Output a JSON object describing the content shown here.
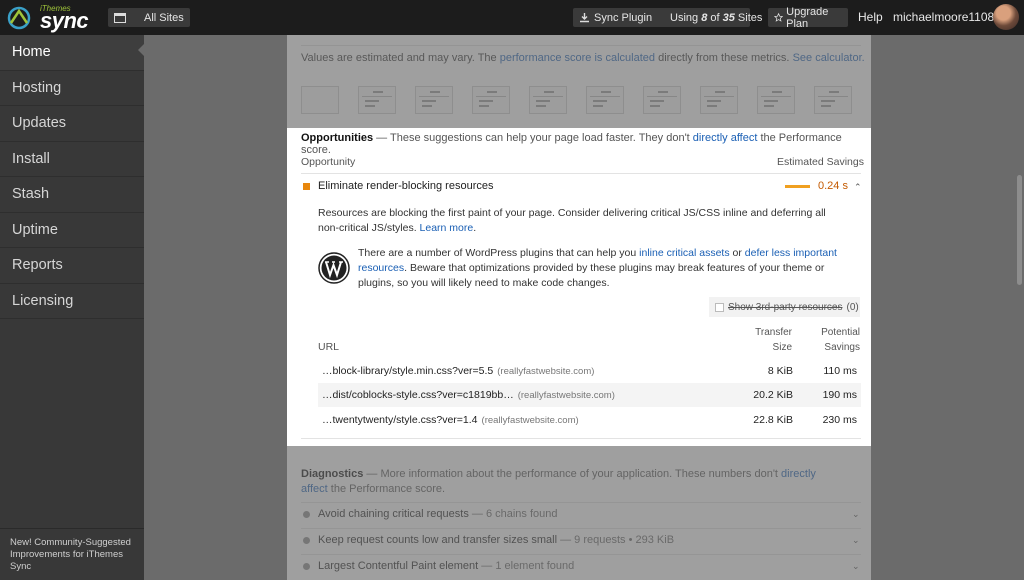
{
  "topbar": {
    "logo_small": "iThemes",
    "logo_big": "sync",
    "all_sites": "All Sites",
    "sync_plugin": "Sync Plugin",
    "using_prefix": "Using ",
    "using_count": "8",
    "using_mid": " of ",
    "using_total": "35",
    "using_suffix": " Sites",
    "upgrade": "Upgrade Plan",
    "help": "Help",
    "username": "michaelmoore1108"
  },
  "sidebar": {
    "items": [
      {
        "label": "Home"
      },
      {
        "label": "Hosting"
      },
      {
        "label": "Updates"
      },
      {
        "label": "Install"
      },
      {
        "label": "Stash"
      },
      {
        "label": "Uptime"
      },
      {
        "label": "Reports"
      },
      {
        "label": "Licensing"
      }
    ],
    "footer": "New! Community-Suggested Improvements for iThemes Sync"
  },
  "metrics_note": {
    "prefix": "Values are estimated and may vary. The ",
    "link1": "performance score is calculated",
    "mid": " directly from these metrics. ",
    "link2": "See calculator."
  },
  "opportunities": {
    "title": "Opportunities",
    "subtitle_prefix": " — These suggestions can help your page load faster. They don't ",
    "subtitle_link": "directly affect",
    "subtitle_suffix": " the Performance score.",
    "col_opportunity": "Opportunity",
    "col_savings": "Estimated Savings",
    "audit": {
      "label": "Eliminate render-blocking resources",
      "savings": "0.24 s"
    },
    "description_prefix": "Resources are blocking the first paint of your page. Consider delivering critical JS/CSS inline and deferring all non-critical JS/styles. ",
    "description_link": "Learn more",
    "description_suffix": ".",
    "wp_prefix": "There are a number of WordPress plugins that can help you ",
    "wp_link1": "inline critical assets",
    "wp_mid": " or ",
    "wp_link2": "defer less important resources",
    "wp_suffix": ". Beware that optimizations provided by these plugins may break features of your theme or plugins, so you will likely need to make code changes.",
    "third_party_label": "Show 3rd-party resources",
    "third_party_count": "(0)",
    "table": {
      "col_url": "URL",
      "col_transfer_1": "Transfer",
      "col_transfer_2": "Size",
      "col_potential_1": "Potential",
      "col_potential_2": "Savings",
      "rows": [
        {
          "url": "…block-library/style.min.css?ver=5.5",
          "host": "(reallyfastwebsite.com)",
          "size": "8 KiB",
          "savings": "110 ms"
        },
        {
          "url": "…dist/coblocks-style.css?ver=c1819bb…",
          "host": "(reallyfastwebsite.com)",
          "size": "20.2 KiB",
          "savings": "190 ms"
        },
        {
          "url": "…twentytwenty/style.css?ver=1.4",
          "host": "(reallyfastwebsite.com)",
          "size": "22.8 KiB",
          "savings": "230 ms"
        }
      ]
    }
  },
  "diagnostics": {
    "title": "Diagnostics",
    "subtitle_prefix": " — More information about the performance of your application. These numbers don't ",
    "subtitle_link": "directly affect",
    "subtitle_suffix": " the Performance score.",
    "items": [
      {
        "label": "Avoid chaining critical requests",
        "sub": " — 6 chains found"
      },
      {
        "label": "Keep request counts low and transfer sizes small",
        "sub": " — 9 requests • 293 KiB"
      },
      {
        "label": "Largest Contentful Paint element",
        "sub": " — 1 element found"
      }
    ]
  },
  "colors": {
    "accent_orange": "#e8870d",
    "link_blue": "#1a5fb4",
    "sidebar_bg": "#383838",
    "topbar_bg": "#1c1c1c"
  },
  "icons": [
    "sync-logo-icon",
    "window-icon",
    "download-icon",
    "star-icon",
    "avatar",
    "wordpress-icon",
    "chevron-up-icon",
    "chevron-down-icon"
  ]
}
